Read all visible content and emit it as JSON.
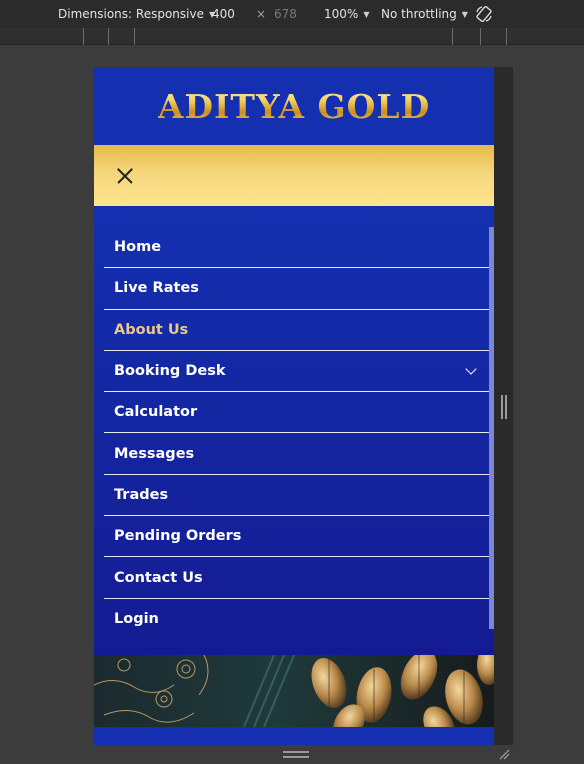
{
  "devtools": {
    "dimensions_label": "Dimensions: Responsive",
    "width": "400",
    "times": "×",
    "height": "678",
    "zoom": "100%",
    "throttling": "No throttling",
    "rotate_icon": "rotate-icon"
  },
  "site": {
    "logo": "ADITYA GOLD",
    "menu": [
      {
        "label": "Home"
      },
      {
        "label": "Live Rates"
      },
      {
        "label": "About Us",
        "active": true
      },
      {
        "label": "Booking Desk",
        "has_submenu": true
      },
      {
        "label": "Calculator"
      },
      {
        "label": "Messages"
      },
      {
        "label": "Trades"
      },
      {
        "label": "Pending Orders"
      },
      {
        "label": "Contact Us"
      },
      {
        "label": "Login"
      }
    ]
  },
  "colors": {
    "brand_blue": "#1430b0",
    "gold": "#f6d67b",
    "active_text": "#e8c98b"
  }
}
